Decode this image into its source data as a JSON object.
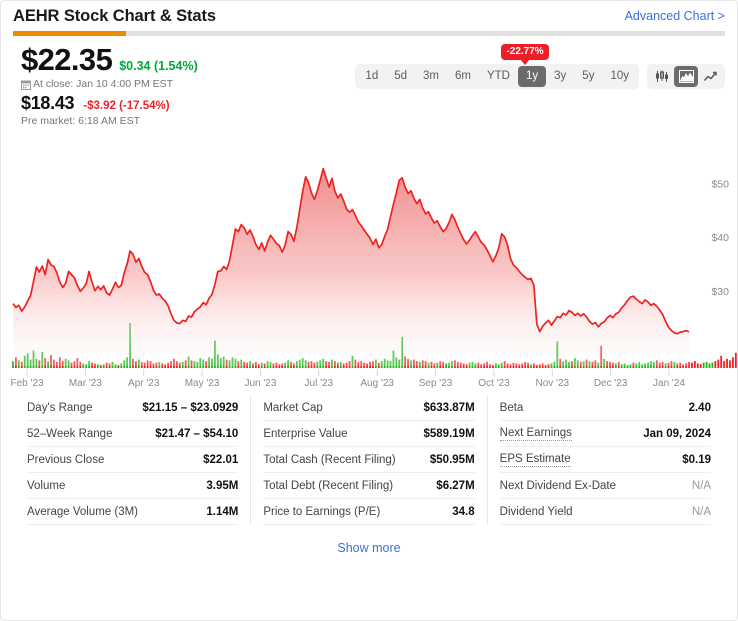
{
  "header": {
    "title": "AEHR Stock Chart & Stats",
    "advanced_link": "Advanced Chart >"
  },
  "quote": {
    "price": "$22.35",
    "change": "$0.34 (1.54%)",
    "change_color": "#00a83e",
    "close_note": "At close: Jan 10 4:00 PM EST",
    "calendar_icon": "calendar-icon",
    "pre_price": "$18.43",
    "pre_change": "-$3.92 (-17.54%)",
    "pre_change_color": "#e8242a",
    "pre_note": "Pre market: 6:18 AM EST"
  },
  "controls": {
    "badge": "-22.77%",
    "badge_color": "#ef1d26",
    "ranges": [
      {
        "label": "1d",
        "active": false
      },
      {
        "label": "5d",
        "active": false
      },
      {
        "label": "3m",
        "active": false
      },
      {
        "label": "6m",
        "active": false
      },
      {
        "label": "YTD",
        "active": false
      },
      {
        "label": "1y",
        "active": true
      },
      {
        "label": "3y",
        "active": false
      },
      {
        "label": "5y",
        "active": false
      },
      {
        "label": "10y",
        "active": false
      }
    ],
    "chart_types": [
      {
        "icon": "candlestick-chart-icon",
        "active": false
      },
      {
        "icon": "area-chart-icon",
        "active": true
      },
      {
        "icon": "line-chart-icon",
        "active": false
      }
    ]
  },
  "chart_data": {
    "type": "area",
    "title": "AEHR Stock Chart & Stats",
    "subtitle": "1y range, -22.77%",
    "xlabel": "",
    "ylabel": "",
    "grid": false,
    "legend_position": "none",
    "line_color": "#ef2222",
    "fill_top_color": "#f49b9b",
    "fill_bottom_color": "#ffffff",
    "ylim": [
      16,
      56
    ],
    "yticks": [
      30,
      40,
      50
    ],
    "ytick_labels": [
      "$30",
      "$40",
      "$50"
    ],
    "xticks": [
      "Feb '23",
      "Mar '23",
      "Apr '23",
      "May '23",
      "Jun '23",
      "Jul '23",
      "Aug '23",
      "Sep '23",
      "Oct '23",
      "Nov '23",
      "Dec '23",
      "Jan '24"
    ],
    "x": [
      0,
      1,
      2,
      3,
      4,
      5,
      6,
      7,
      8,
      9,
      10,
      11,
      12,
      13,
      14,
      15,
      16,
      17,
      18,
      19,
      20,
      21,
      22,
      23,
      24,
      25,
      26,
      27,
      28,
      29,
      30,
      31,
      32,
      33,
      34,
      35,
      36,
      37,
      38,
      39,
      40,
      41,
      42,
      43,
      44,
      45,
      46,
      47,
      48,
      49,
      50,
      51,
      52,
      53,
      54,
      55,
      56,
      57,
      58,
      59,
      60,
      61,
      62,
      63,
      64,
      65,
      66,
      67,
      68,
      69,
      70,
      71,
      72,
      73,
      74,
      75,
      76,
      77,
      78,
      79,
      80,
      81,
      82,
      83,
      84,
      85,
      86,
      87,
      88,
      89,
      90,
      91,
      92,
      93,
      94,
      95,
      96,
      97,
      98,
      99,
      100,
      101,
      102,
      103,
      104,
      105,
      106,
      107,
      108,
      109,
      110,
      111,
      112,
      113,
      114,
      115,
      116,
      117,
      118,
      119,
      120,
      121,
      122,
      123,
      124,
      125,
      126,
      127,
      128,
      129,
      130,
      131,
      132,
      133,
      134,
      135,
      136,
      137,
      138,
      139,
      140,
      141,
      142,
      143,
      144,
      145,
      146,
      147,
      148,
      149,
      150,
      151,
      152,
      153,
      154,
      155,
      156,
      157,
      158,
      159,
      160,
      161,
      162,
      163,
      164,
      165,
      166,
      167,
      168,
      169,
      170,
      171,
      172,
      173,
      174,
      175,
      176,
      177,
      178,
      179,
      180,
      181,
      182,
      183,
      184,
      185,
      186,
      187,
      188,
      189,
      190,
      191,
      192,
      193,
      194,
      195,
      196,
      197,
      198,
      199,
      200,
      201,
      202,
      203,
      204,
      205,
      206,
      207,
      208,
      209,
      210,
      211,
      212,
      213,
      214,
      215,
      216,
      217,
      218,
      219,
      220,
      221,
      222,
      223,
      224,
      225,
      226,
      227,
      228,
      229,
      230,
      231,
      232,
      233,
      234,
      235,
      236,
      237,
      238,
      239,
      240,
      241,
      242,
      243,
      244,
      245,
      246,
      247,
      248,
      249
    ],
    "close": [
      27.6,
      26.9,
      27.3,
      26.2,
      27.0,
      28.1,
      29.1,
      31.7,
      34.4,
      33.5,
      34.6,
      33.0,
      35.8,
      34.8,
      34.5,
      33.3,
      31.6,
      30.6,
      31.4,
      33.6,
      33.0,
      32.4,
      31.0,
      29.9,
      30.5,
      31.3,
      33.6,
      31.6,
      30.0,
      30.8,
      30.2,
      30.9,
      29.6,
      29.2,
      30.3,
      31.6,
      30.6,
      31.0,
      33.3,
      35.0,
      37.4,
      36.8,
      35.3,
      36.0,
      34.5,
      33.4,
      33.0,
      31.7,
      30.1,
      29.2,
      29.4,
      28.6,
      28.1,
      27.2,
      25.7,
      24.5,
      24.0,
      23.9,
      24.5,
      24.3,
      25.3,
      25.1,
      26.1,
      26.6,
      27.0,
      27.8,
      27.4,
      28.6,
      29.3,
      31.2,
      33.6,
      33.7,
      34.5,
      34.0,
      35.6,
      38.5,
      41.5,
      41.0,
      42.3,
      41.7,
      40.5,
      41.3,
      40.1,
      38.6,
      37.7,
      38.9,
      37.4,
      39.1,
      40.3,
      39.6,
      38.8,
      38.4,
      37.2,
      38.5,
      41.0,
      40.5,
      39.2,
      41.8,
      45.2,
      48.5,
      51.2,
      50.1,
      48.2,
      47.0,
      48.6,
      50.6,
      52.7,
      51.0,
      49.3,
      50.9,
      48.5,
      47.3,
      48.0,
      46.7,
      45.2,
      44.6,
      45.1,
      44.0,
      42.8,
      42.1,
      41.3,
      40.5,
      39.8,
      38.6,
      39.6,
      38.0,
      38.6,
      40.1,
      41.4,
      43.8,
      46.1,
      48.2,
      50.6,
      51.0,
      49.3,
      48.1,
      48.6,
      47.2,
      46.2,
      47.0,
      45.4,
      44.3,
      44.7,
      43.5,
      42.6,
      43.0,
      41.9,
      41.0,
      41.6,
      42.7,
      44.2,
      43.2,
      41.8,
      40.6,
      39.5,
      38.7,
      39.4,
      40.3,
      41.0,
      40.0,
      39.0,
      38.5,
      37.6,
      36.5,
      35.4,
      36.5,
      38.0,
      40.6,
      40.0,
      38.5,
      36.0,
      34.8,
      34.3,
      33.6,
      33.0,
      32.5,
      32.1,
      32.3,
      31.0,
      23.8,
      22.4,
      23.4,
      24.0,
      24.5,
      23.6,
      24.4,
      25.2,
      25.0,
      25.8,
      25.5,
      26.3,
      26.0,
      25.4,
      25.8,
      25.3,
      25.7,
      25.1,
      24.3,
      23.8,
      24.1,
      23.3,
      23.9,
      24.2,
      24.9,
      25.4,
      25.0,
      25.7,
      26.0,
      26.8,
      27.4,
      28.2,
      28.8,
      29.0,
      28.4,
      28.0,
      27.6,
      28.3,
      27.9,
      27.3,
      27.6,
      27.1,
      26.4,
      25.6,
      24.3,
      23.2,
      22.6,
      22.2,
      22.0,
      22.3,
      22.4,
      22.6,
      22.35
    ],
    "volume": [
      0.9,
      1.4,
      1.0,
      0.8,
      1.6,
      1.9,
      1.1,
      2.3,
      1.2,
      1.0,
      2.1,
      1.3,
      0.9,
      1.7,
      1.1,
      0.8,
      1.4,
      0.9,
      1.2,
      1.0,
      0.7,
      0.9,
      1.3,
      0.8,
      0.6,
      0.5,
      0.9,
      0.7,
      0.6,
      0.5,
      0.4,
      0.5,
      0.7,
      0.6,
      0.8,
      0.5,
      0.4,
      0.6,
      1.0,
      1.4,
      5.9,
      1.2,
      0.9,
      1.1,
      0.8,
      0.7,
      1.0,
      0.9,
      0.6,
      0.7,
      0.8,
      0.6,
      0.5,
      0.7,
      0.9,
      1.2,
      0.9,
      0.7,
      0.8,
      1.0,
      1.5,
      1.0,
      0.9,
      0.8,
      1.3,
      1.1,
      0.9,
      1.4,
      1.2,
      3.6,
      1.8,
      1.3,
      1.5,
      1.1,
      1.0,
      1.4,
      1.2,
      0.9,
      1.1,
      0.8,
      0.7,
      0.9,
      0.6,
      0.8,
      0.5,
      0.7,
      0.6,
      0.9,
      0.8,
      0.6,
      0.7,
      0.5,
      0.6,
      0.7,
      1.0,
      0.8,
      0.6,
      0.9,
      1.1,
      1.3,
      1.0,
      0.8,
      0.9,
      0.7,
      0.8,
      1.0,
      1.2,
      0.9,
      0.8,
      1.1,
      0.9,
      0.7,
      0.8,
      0.6,
      0.7,
      0.9,
      1.6,
      1.1,
      0.8,
      0.9,
      0.7,
      0.6,
      0.8,
      0.9,
      1.1,
      0.7,
      0.9,
      1.2,
      1.0,
      0.9,
      2.3,
      1.4,
      1.1,
      4.1,
      1.5,
      1.2,
      1.0,
      1.1,
      0.9,
      0.8,
      1.0,
      0.9,
      0.7,
      0.8,
      0.6,
      0.7,
      0.9,
      0.8,
      0.6,
      0.7,
      0.9,
      1.0,
      0.8,
      0.7,
      0.6,
      0.5,
      0.7,
      0.8,
      0.6,
      0.7,
      0.5,
      0.6,
      0.8,
      0.5,
      0.4,
      0.6,
      0.5,
      0.7,
      0.9,
      0.6,
      0.5,
      0.7,
      0.6,
      0.5,
      0.6,
      0.8,
      0.7,
      0.5,
      0.6,
      0.4,
      0.5,
      0.6,
      0.4,
      0.5,
      0.6,
      0.8,
      3.5,
      1.2,
      0.9,
      1.1,
      0.8,
      0.9,
      1.3,
      1.0,
      0.8,
      0.9,
      1.1,
      0.9,
      0.8,
      1.0,
      0.7,
      2.9,
      1.2,
      0.9,
      0.8,
      0.7,
      0.6,
      0.8,
      0.5,
      0.6,
      0.4,
      0.5,
      0.7,
      0.6,
      0.8,
      0.5,
      0.6,
      0.7,
      0.9,
      0.8,
      1.0,
      0.7,
      0.8,
      0.6,
      0.7,
      0.9,
      0.8,
      0.6,
      0.7,
      0.5,
      0.6,
      0.8,
      0.7,
      0.9,
      0.6,
      0.5,
      0.7,
      0.8,
      0.6,
      0.7,
      0.9,
      1.1,
      1.6,
      0.9,
      1.2,
      1.0,
      1.4,
      2.0,
      2.6,
      3.2,
      3.95
    ],
    "volume_up": [
      true,
      false,
      true,
      false,
      true,
      true,
      true,
      true,
      true,
      false,
      true,
      false,
      true,
      false,
      false,
      false,
      false,
      false,
      true,
      true,
      false,
      false,
      false,
      false,
      true,
      true,
      true,
      false,
      false,
      true,
      false,
      true,
      false,
      false,
      true,
      true,
      false,
      true,
      true,
      true,
      true,
      false,
      false,
      true,
      false,
      false,
      false,
      false,
      false,
      false,
      true,
      false,
      false,
      false,
      false,
      false,
      false,
      false,
      true,
      false,
      true,
      false,
      true,
      true,
      true,
      true,
      false,
      true,
      true,
      true,
      true,
      true,
      true,
      false,
      true,
      true,
      true,
      false,
      true,
      false,
      false,
      true,
      false,
      false,
      false,
      true,
      false,
      true,
      true,
      false,
      false,
      false,
      false,
      true,
      true,
      false,
      false,
      true,
      true,
      true,
      true,
      false,
      false,
      false,
      true,
      true,
      true,
      false,
      false,
      true,
      false,
      false,
      true,
      false,
      false,
      false,
      true,
      false,
      false,
      false,
      false,
      false,
      false,
      false,
      true,
      false,
      true,
      true,
      true,
      true,
      true,
      true,
      true,
      true,
      false,
      false,
      true,
      false,
      false,
      true,
      false,
      false,
      true,
      false,
      false,
      true,
      false,
      false,
      true,
      true,
      true,
      false,
      false,
      false,
      false,
      false,
      true,
      true,
      true,
      false,
      false,
      false,
      false,
      false,
      false,
      true,
      true,
      true,
      false,
      false,
      false,
      false,
      false,
      false,
      false,
      false,
      false,
      true,
      false,
      false,
      false,
      false,
      false,
      false,
      true,
      true,
      true,
      false,
      true,
      true,
      true,
      false,
      true,
      true,
      false,
      true,
      false,
      true,
      false,
      false,
      true,
      false,
      true,
      false,
      false,
      false,
      true,
      false,
      true,
      true,
      true,
      true,
      false,
      true,
      true,
      true,
      true,
      true,
      true,
      true,
      false,
      false,
      false,
      true,
      false,
      false,
      true,
      false,
      false,
      false,
      false,
      false,
      false,
      false,
      false,
      false,
      true,
      true,
      true,
      true
    ]
  },
  "stats": {
    "columns": [
      {
        "rows": [
          {
            "label": "Day's Range",
            "value": "$21.15 – $23.0929",
            "na": false,
            "hint": false
          },
          {
            "label": "52–Week Range",
            "value": "$21.47 – $54.10",
            "na": false,
            "hint": false
          },
          {
            "label": "Previous Close",
            "value": "$22.01",
            "na": false,
            "hint": false
          },
          {
            "label": "Volume",
            "value": "3.95M",
            "na": false,
            "hint": false
          },
          {
            "label": "Average Volume (3M)",
            "value": "1.14M",
            "na": false,
            "hint": false
          }
        ]
      },
      {
        "rows": [
          {
            "label": "Market Cap",
            "value": "$633.87M",
            "na": false,
            "hint": false
          },
          {
            "label": "Enterprise Value",
            "value": "$589.19M",
            "na": false,
            "hint": false
          },
          {
            "label": "Total Cash (Recent Filing)",
            "value": "$50.95M",
            "na": false,
            "hint": false
          },
          {
            "label": "Total Debt (Recent Filing)",
            "value": "$6.27M",
            "na": false,
            "hint": false
          },
          {
            "label": "Price to Earnings (P/E)",
            "value": "34.8",
            "na": false,
            "hint": false
          }
        ]
      },
      {
        "rows": [
          {
            "label": "Beta",
            "value": "2.40",
            "na": false,
            "hint": false
          },
          {
            "label": "Next Earnings",
            "value": "Jan 09, 2024",
            "na": false,
            "hint": true
          },
          {
            "label": "EPS Estimate",
            "value": "$0.19",
            "na": false,
            "hint": true
          },
          {
            "label": "Next Dividend Ex-Date",
            "value": "N/A",
            "na": true,
            "hint": false
          },
          {
            "label": "Dividend Yield",
            "value": "N/A",
            "na": true,
            "hint": false
          }
        ]
      }
    ],
    "show_more": "Show more"
  }
}
